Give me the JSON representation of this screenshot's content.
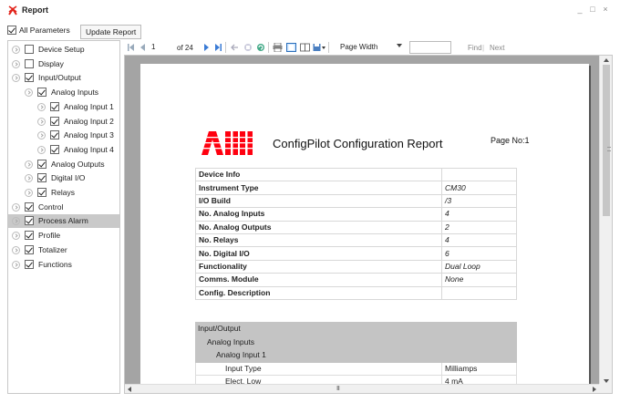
{
  "window": {
    "title": "Report",
    "minimize_glyph": "_",
    "maximize_glyph": "□",
    "close_glyph": "×"
  },
  "options": {
    "all_parameters_label": "All Parameters",
    "all_parameters_checked": true,
    "update_button": "Update Report"
  },
  "tree": [
    {
      "label": "Device Setup",
      "checked": false,
      "level": 0
    },
    {
      "label": "Display",
      "checked": false,
      "level": 0
    },
    {
      "label": "Input/Output",
      "checked": true,
      "level": 0
    },
    {
      "label": "Analog Inputs",
      "checked": true,
      "level": 1
    },
    {
      "label": "Analog Input 1",
      "checked": true,
      "level": 2
    },
    {
      "label": "Analog Input 2",
      "checked": true,
      "level": 2
    },
    {
      "label": "Analog Input 3",
      "checked": true,
      "level": 2
    },
    {
      "label": "Analog Input 4",
      "checked": true,
      "level": 2
    },
    {
      "label": "Analog Outputs",
      "checked": true,
      "level": 1
    },
    {
      "label": "Digital I/O",
      "checked": true,
      "level": 1
    },
    {
      "label": "Relays",
      "checked": true,
      "level": 1
    },
    {
      "label": "Control",
      "checked": true,
      "level": 0
    },
    {
      "label": "Process Alarm",
      "checked": true,
      "level": 0,
      "selected": true
    },
    {
      "label": "Profile",
      "checked": true,
      "level": 0
    },
    {
      "label": "Totalizer",
      "checked": true,
      "level": 0
    },
    {
      "label": "Functions",
      "checked": true,
      "level": 0
    }
  ],
  "toolbar": {
    "first_icon": "first-page-icon",
    "prev_icon": "prev-page-icon",
    "page_value": "1",
    "of_text": "of 24",
    "next_icon": "next-page-icon",
    "last_icon": "last-page-icon",
    "back_icon": "back-icon",
    "stop_icon": "stop-icon",
    "refresh_icon": "refresh-icon",
    "print_icon": "print-icon",
    "layout_icon": "print-layout-icon",
    "page_setup_icon": "page-setup-icon",
    "export_icon": "export-icon",
    "zoom_value": "Page Width",
    "find_placeholder": "",
    "find_label": "Find",
    "separator": "|",
    "next_label": "Next"
  },
  "report": {
    "logo": "ABB",
    "title": "ConfigPilot Configuration Report",
    "page_no": "Page No:1",
    "device_info": [
      {
        "key": "Device Info",
        "value": ""
      },
      {
        "key": "Instrument Type",
        "value": "CM30"
      },
      {
        "key": "I/O Build",
        "value": "/3"
      },
      {
        "key": "No. Analog Inputs",
        "value": "4"
      },
      {
        "key": "No. Analog Outputs",
        "value": "2"
      },
      {
        "key": "No. Relays",
        "value": "4"
      },
      {
        "key": "No. Digital I/O",
        "value": "6"
      },
      {
        "key": "Functionality",
        "value": "Dual Loop"
      },
      {
        "key": "Comms. Module",
        "value": "None"
      },
      {
        "key": "Config. Description",
        "value": ""
      }
    ],
    "io_rows": [
      {
        "key": "Input/Output",
        "value": "",
        "header": true,
        "indent": 0
      },
      {
        "key": "Analog Inputs",
        "value": "",
        "header": true,
        "indent": 1
      },
      {
        "key": "Analog Input 1",
        "value": "",
        "header": true,
        "indent": 2
      },
      {
        "key": "Input Type",
        "value": "Milliamps",
        "header": false,
        "indent": 3
      },
      {
        "key": "Elect. Low",
        "value": "4 mA",
        "header": false,
        "indent": 3
      }
    ]
  },
  "scrollbar": {
    "hgrip": "III"
  },
  "colors": {
    "brand_red": "#ff000f",
    "selected_row": "#c9c9c9",
    "report_gray": "#a4a4a4"
  }
}
